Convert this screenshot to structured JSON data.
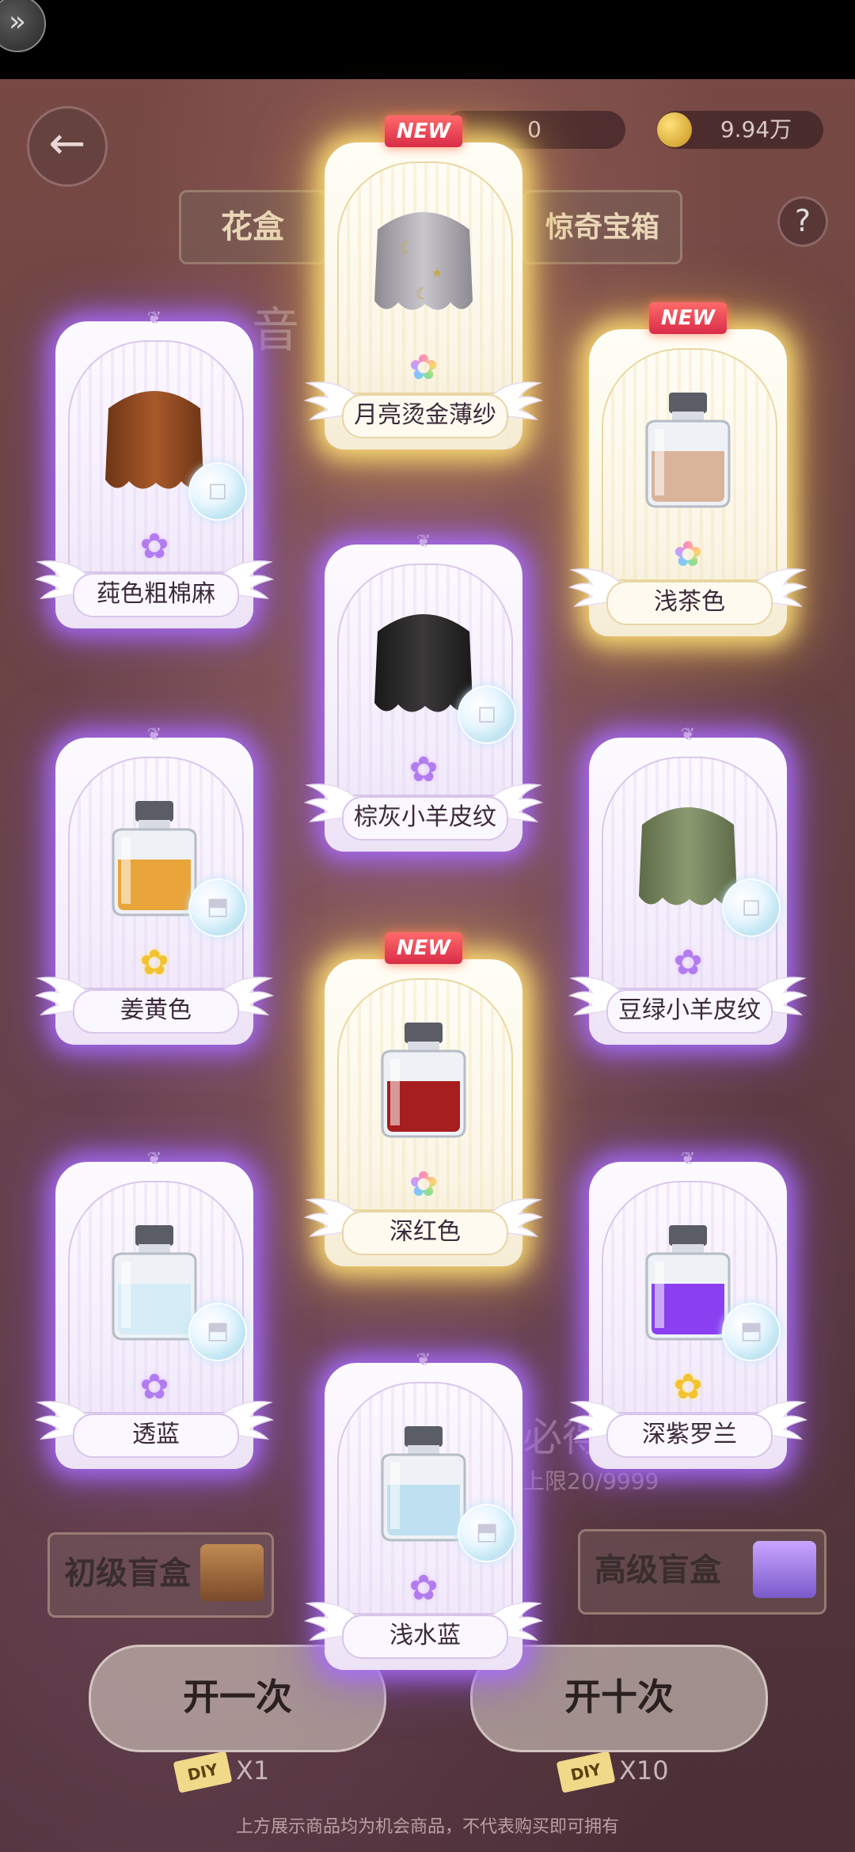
{
  "header": {
    "currency_a": "0",
    "currency_b": "9.94万",
    "tab_left": "花盒",
    "tab_right": "惊奇宝箱",
    "help_label": "?"
  },
  "sections": {
    "bg_label_1": "音",
    "bg_label_2": "必得",
    "limit_text": "上限20/9999"
  },
  "boxes": {
    "basic": "初级盲盒",
    "advanced": "高级盲盒"
  },
  "actions": {
    "open_once": "开一次",
    "open_ten": "开十次",
    "diy_ticket": "DIY",
    "cost_once": "X1",
    "cost_ten": "X10"
  },
  "footer_note": "上方展示商品均为机会商品，不代表购买即可拥有",
  "cards": [
    {
      "name": "月亮烫金薄纱",
      "new": "NEW",
      "rarity": "gold",
      "flower": "rainbow",
      "item": "fabric-silver-moon"
    },
    {
      "name": "莼色粗棉麻",
      "rarity": "purple",
      "flower": "purple",
      "item": "fabric-brown"
    },
    {
      "name": "浅茶色",
      "new": "NEW",
      "rarity": "gold",
      "flower": "rainbow",
      "item": "dye-bottle-tan"
    },
    {
      "name": "棕灰小羊皮纹",
      "rarity": "purple",
      "flower": "purple",
      "item": "fabric-black"
    },
    {
      "name": "姜黄色",
      "rarity": "purple",
      "flower": "gold",
      "item": "dye-bottle-orange"
    },
    {
      "name": "豆绿小羊皮纹",
      "rarity": "purple",
      "flower": "purple",
      "item": "fabric-green"
    },
    {
      "name": "深红色",
      "new": "NEW",
      "rarity": "gold",
      "flower": "rainbow",
      "item": "dye-bottle-red"
    },
    {
      "name": "透蓝",
      "rarity": "purple",
      "flower": "purple",
      "item": "dye-bottle-lightblue"
    },
    {
      "name": "深紫罗兰",
      "rarity": "purple",
      "flower": "gold",
      "item": "dye-bottle-violet"
    },
    {
      "name": "浅水蓝",
      "rarity": "purple",
      "flower": "purple",
      "item": "dye-bottle-aqua"
    }
  ],
  "colors": {
    "purple_glow": "#a66cff",
    "gold_glow": "#ffd96a",
    "new_badge": "#e23a52"
  }
}
